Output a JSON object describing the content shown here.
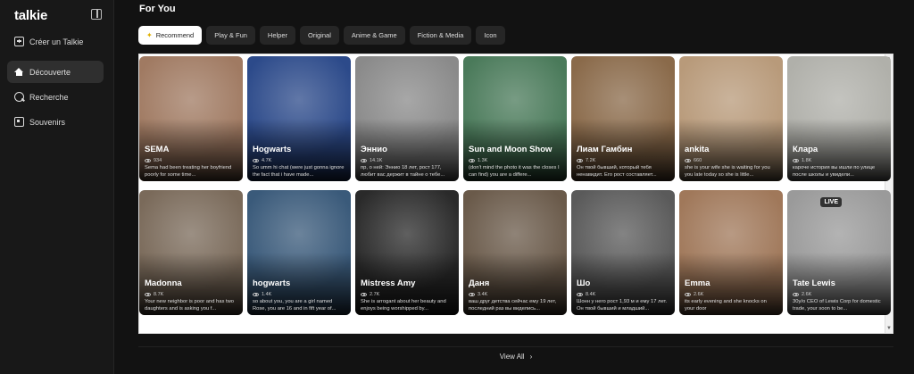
{
  "app": {
    "logo": "talkie"
  },
  "sidebar": {
    "create_label": "Créer un Talkie",
    "items": [
      {
        "label": "Découverte",
        "icon": "home-icon",
        "active": true
      },
      {
        "label": "Recherche",
        "icon": "search-icon",
        "active": false
      },
      {
        "label": "Souvenirs",
        "icon": "memory-icon",
        "active": false
      }
    ]
  },
  "main": {
    "section_title": "For You",
    "tabs": [
      "Recommend",
      "Play & Fun",
      "Helper",
      "Original",
      "Anime & Game",
      "Fiction & Media",
      "Icon"
    ],
    "active_tab": "Recommend",
    "cards_row1": [
      {
        "name": "SEMA",
        "views": "934",
        "desc": "Sema had been treating her boyfriend poorly for some time...",
        "bg": "#a07a62"
      },
      {
        "name": "Hogwarts",
        "views": "4.7K",
        "desc": "So umm hi chat (were just gonna ignore the fact that i have made...",
        "bg": "#2c4a8a"
      },
      {
        "name": "Эннио",
        "views": "14.1K",
        "desc": "пр, о ней: Эннио 18 лет, рост 177, любит вас держит в тайне о тебе...",
        "bg": "#8a8a8a"
      },
      {
        "name": "Sun and Moon Show",
        "views": "1.3K",
        "desc": "(don't mind the photo it was the closes I can find) you are a differe...",
        "bg": "#4a7a5a"
      },
      {
        "name": "Лиам Гамбин",
        "views": "7.2K",
        "desc": "Он твой бывший, который тебя ненавидит. Его рост составляет...",
        "bg": "#8a6a4a"
      },
      {
        "name": "ankita",
        "views": "660",
        "desc": "she is your wife she is waiting for you you late today so she is little...",
        "bg": "#b89a7a"
      },
      {
        "name": "Клара",
        "views": "1.8K",
        "desc": "кароче история вы ишли по улице после школы и увидели...",
        "bg": "#b0b0aa"
      }
    ],
    "cards_row2": [
      {
        "name": "Madonna",
        "views": "8.7K",
        "desc": "Your new neighbor is poor and has two daughters and is asking you f...",
        "bg": "#7a6a5a"
      },
      {
        "name": "hogwarts",
        "views": "1.4K",
        "desc": "so about you, you are a girl named Rose, you are 16 and in fift year of...",
        "bg": "#3a5a7a"
      },
      {
        "name": "Mistress Amy",
        "views": "2.7K",
        "desc": "She is arrogant about her beauty and enjoys being worshipped by...",
        "bg": "#2a2a2a"
      },
      {
        "name": "Даня",
        "views": "3.4K",
        "desc": "ваш друг детства сейчас ему 19 лет, последний раз вы виделись...",
        "bg": "#6a5a4a"
      },
      {
        "name": "Шо",
        "views": "8.4K",
        "desc": "Шонн у него рост 1,93 м и ему 17 лет. Он твой бывший и младший...",
        "bg": "#5a5a5a"
      },
      {
        "name": "Emma",
        "views": "2.6K",
        "desc": "its early evening and she knocks on your door",
        "bg": "#a0785a"
      },
      {
        "name": "Tate Lewis",
        "views": "2.6K",
        "desc": "30y/o CEO of Lewis Corp for domestic trade, your soon to be...",
        "bg": "#9a9a9a",
        "live": "LIVE"
      }
    ],
    "view_all": "View All"
  }
}
